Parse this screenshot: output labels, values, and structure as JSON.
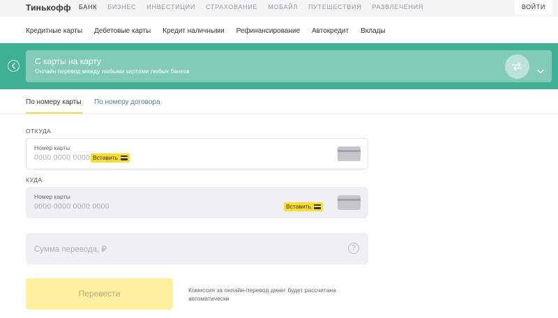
{
  "header": {
    "logo": "Тинькофф",
    "nav": [
      "БАНК",
      "БИЗНЕС",
      "ИНВЕСТИЦИИ",
      "СТРАХОВАНИЕ",
      "МОБАЙЛ",
      "ПУТЕШЕСТВИЯ",
      "РАЗВЛЕЧЕНИЯ"
    ],
    "active_nav": "БАНК",
    "login_label": "ВОЙТИ"
  },
  "subnav": [
    "Кредитные карты",
    "Дебетовые карты",
    "Кредит наличными",
    "Рефинансирование",
    "Автокредит",
    "Вклады"
  ],
  "banner": {
    "title": "С карты на карту",
    "subtitle": "Онлайн перевод между любыми картами любых банков",
    "icon": "transfer-arrows-icon",
    "color": "#3fb093"
  },
  "tabs": [
    {
      "label": "По номеру карты",
      "active": true
    },
    {
      "label": "По номеру договора",
      "active": false
    }
  ],
  "form": {
    "from": {
      "section_label": "ОТКУДА",
      "field_label": "Номер карты",
      "placeholder": "0000 0000 0000 0000",
      "paste_label": "Вставить"
    },
    "to": {
      "section_label": "КУДА",
      "field_label": "Номер карты",
      "placeholder": "0000 0000 0000 0000",
      "paste_label": "Вставить"
    },
    "amount_placeholder": "Сумма перевода, ₽",
    "help_symbol": "?",
    "submit_label": "Перевести",
    "commission_note": "Комиссия за онлайн-перевод денег будет рассчитана автоматически"
  },
  "colors": {
    "accent_yellow": "#ffdd2d",
    "link_blue": "#4a7fb0"
  }
}
